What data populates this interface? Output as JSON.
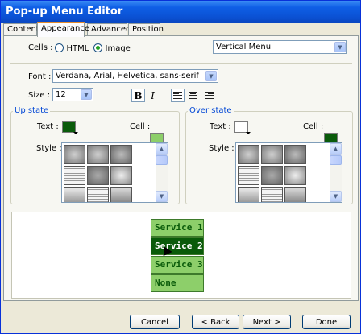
{
  "window": {
    "title": "Pop-up Menu Editor"
  },
  "tabs": [
    {
      "label": "Content"
    },
    {
      "label": "Appearance"
    },
    {
      "label": "Advanced"
    },
    {
      "label": "Position"
    }
  ],
  "cells": {
    "label": "Cells :",
    "html_label": "HTML",
    "image_label": "Image",
    "selected": "Image",
    "layout_value": "Vertical Menu"
  },
  "font": {
    "label": "Font :",
    "value": "Verdana, Arial, Helvetica, sans-serif",
    "size_label": "Size :",
    "size_value": "12",
    "bold_glyph": "B",
    "italic_glyph": "I"
  },
  "up_state": {
    "title": "Up state",
    "text_label": "Text :",
    "cell_label": "Cell :",
    "style_label": "Style :",
    "text_color": "#0a5b0a",
    "cell_color": "#8dcf6a"
  },
  "over_state": {
    "title": "Over state",
    "text_label": "Text :",
    "cell_label": "Cell :",
    "style_label": "Style :",
    "text_color": "#ffffff",
    "cell_color": "#0a5b0a"
  },
  "preview": {
    "items": [
      {
        "label": "Service 1"
      },
      {
        "label": "Service 2"
      },
      {
        "label": "Service 3"
      },
      {
        "label": "None"
      }
    ]
  },
  "buttons": {
    "cancel": "Cancel",
    "back": "< Back",
    "next": "Next >",
    "done": "Done"
  }
}
